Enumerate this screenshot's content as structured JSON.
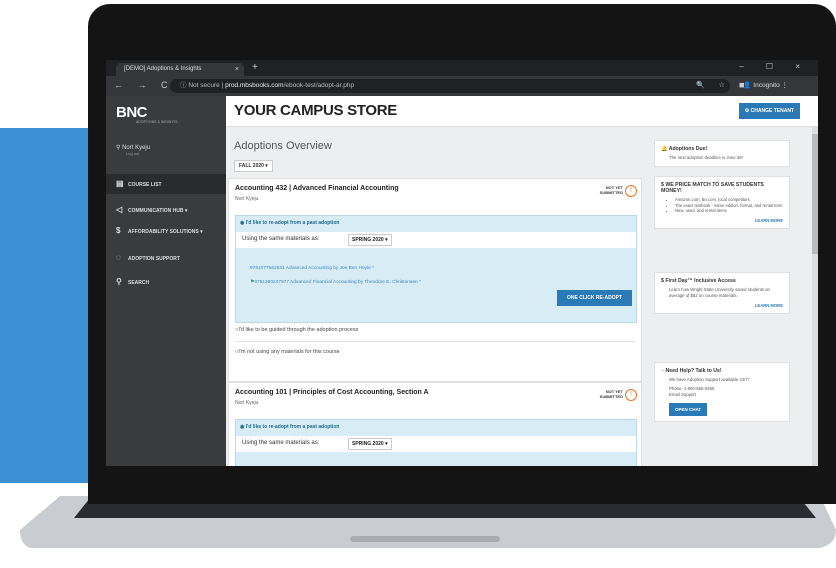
{
  "browser": {
    "tab_title": "[DEMO] Adoptions & Insights",
    "tab_close": "×",
    "new_tab": "+",
    "window_controls": "–  ☐  ×",
    "nav_icons": "← → C",
    "security": "Not secure",
    "url_host": "prod.mbsbooks.com",
    "url_path": "/ebook-test/adopt-ar.php",
    "ext_icons": "🔍 ☆ ◼",
    "profile": "Incognito"
  },
  "sidebar": {
    "logo": "BNC",
    "logo_sub": "ADOPTIONS & INSIGHTS",
    "user_name": "Nort Kyeju",
    "user_role": "Log out",
    "items": [
      {
        "label": "COURSE LIST"
      },
      {
        "label": "COMMUNICATION HUB"
      },
      {
        "label": "AFFORDABILITY SOLUTIONS"
      },
      {
        "label": "ADOPTION SUPPORT"
      },
      {
        "label": "SEARCH"
      }
    ]
  },
  "header": {
    "title": "YOUR CAMPUS STORE",
    "change_tenant": "⚙ CHANGE TENANT"
  },
  "overview": {
    "title": "Adoptions Overview",
    "term": "FALL 2020 ▾"
  },
  "courses": [
    {
      "title": "Accounting 432 | Advanced Financial Accounting",
      "instructor": "Nort Kyeju",
      "status": "NOT YET SUBMITTED",
      "readopt_label": "I'd like to re-adopt from a past adoption",
      "materials_label": "Using the same materials as:",
      "materials_term": "SPRING 2020 ▾",
      "books": [
        "9781077662831  Advanced Accounting by Joe Ben Hoyle *",
        "9781260247977  Advanced Financial Accounting by Theodore E. Christensen *"
      ],
      "adopt_button": "ONE CLICK RE-ADOPT",
      "option_guided": "I'd like to be guided through the adoption process",
      "option_none": "I'm not using any materials for this course"
    },
    {
      "title": "Accounting 101 | Principles of Cost Accounting, Section A",
      "instructor": "Nort Kyeju",
      "status": "NOT YET SUBMITTED",
      "readopt_label": "I'd like to re-adopt from a past adoption",
      "materials_label": "Using the same materials as:",
      "materials_term": "SPRING 2020 ▾"
    }
  ],
  "right": {
    "due": {
      "title": "Adoptions Due!",
      "text": "The next adoption deadline is June 30!"
    },
    "price_match": {
      "title": "WE PRICE MATCH TO SAVE STUDENTS MONEY!",
      "bullets": [
        "Amazon.com, Bn.com, local competitors",
        "The exact textbook - same edition, format, and rental term",
        "New, used, and rental items"
      ],
      "learn": "LEARN MORE"
    },
    "first_day": {
      "title": "First Day™ Inclusive Access",
      "text": "Learn how Wright State University saved students an average of $52 on course materials.",
      "learn": "LEARN MORE"
    },
    "help": {
      "title": "Need Help? Talk to Us!",
      "text": "We have Adoption Support available 24/7!",
      "phone": "Phone: 1-800-555-0456",
      "email": "Email Support",
      "chat": "OPEN CHAT"
    }
  }
}
